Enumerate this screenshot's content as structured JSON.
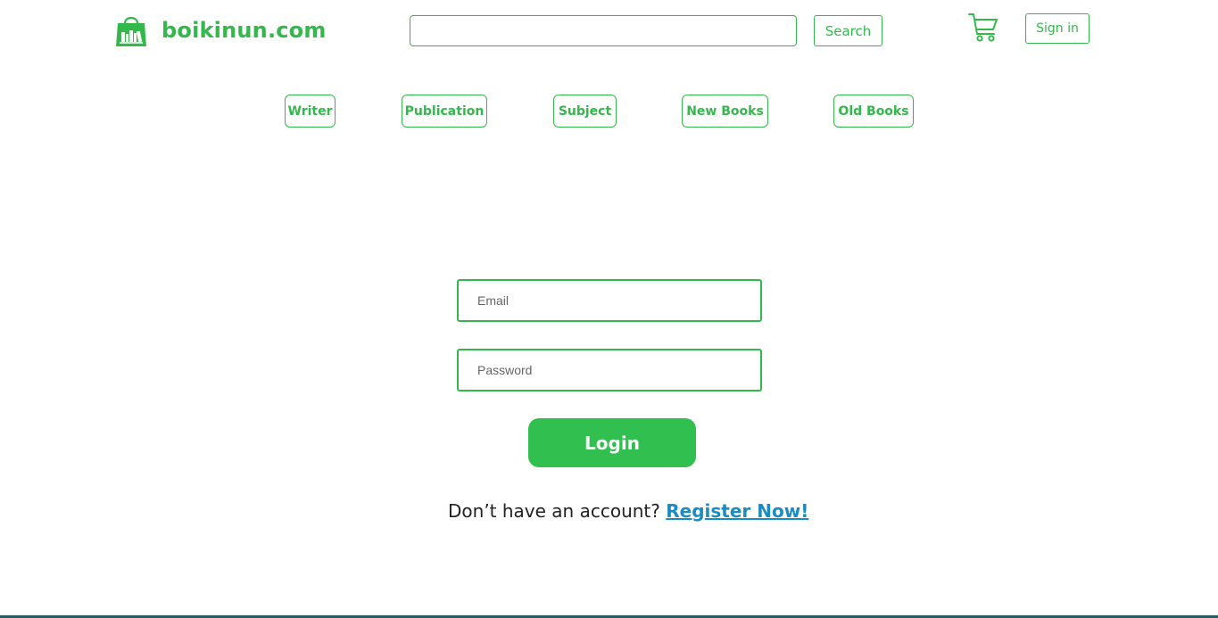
{
  "header": {
    "logo_text": "boikinun.com",
    "logo_icon": "shopping-bag-books-icon",
    "search": {
      "value": "",
      "placeholder": "",
      "button_label": "Search"
    },
    "cart_icon": "cart-icon",
    "signin_label": "Sign in"
  },
  "nav": {
    "items": [
      {
        "label": "Writer"
      },
      {
        "label": "Publication"
      },
      {
        "label": "Subject"
      },
      {
        "label": "New Books"
      },
      {
        "label": "Old Books"
      }
    ]
  },
  "login_form": {
    "email_placeholder": "Email",
    "password_placeholder": "Password",
    "login_label": "Login",
    "register_prompt": "Don’t have an account?",
    "register_link": "Register Now!"
  },
  "colors": {
    "accent": "#33b84b",
    "button": "#31bf4f",
    "link": "#1a8cc4"
  }
}
